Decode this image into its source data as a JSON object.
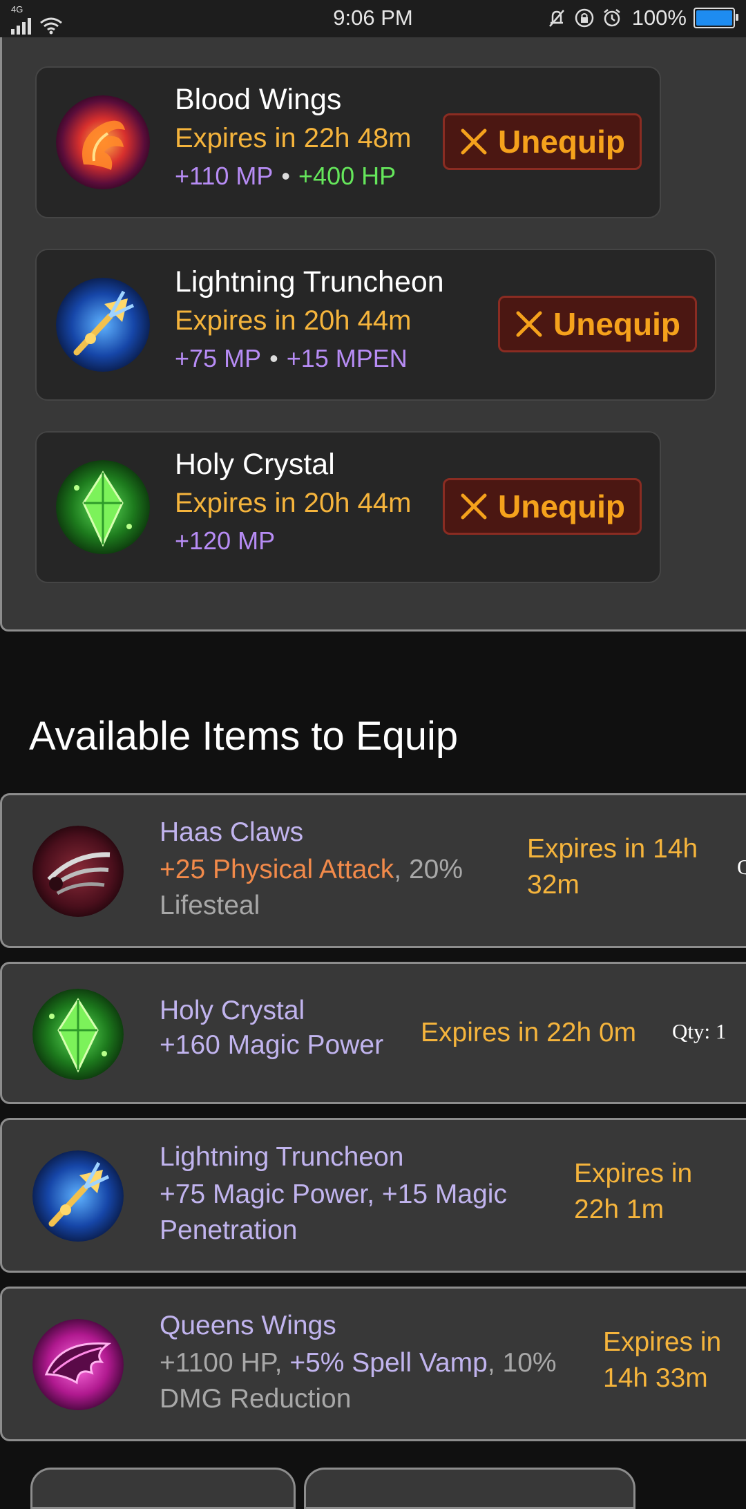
{
  "status_bar": {
    "network": "4G",
    "time": "9:06 PM",
    "battery_percent": "100%",
    "icons": [
      "signal-icon",
      "wifi-icon",
      "mute-icon",
      "rotation-lock-icon",
      "alarm-icon",
      "battery-icon"
    ]
  },
  "equipped": [
    {
      "name": "Blood Wings",
      "expires": "Expires in 22h 48m",
      "stats": [
        {
          "text": "+110 MP",
          "color": "purple"
        },
        {
          "text": "+400 HP",
          "color": "green"
        }
      ],
      "separator": "•",
      "action": "Unequip",
      "icon": "blood-wings-icon"
    },
    {
      "name": "Lightning Truncheon",
      "expires": "Expires in 20h 44m",
      "stats": [
        {
          "text": "+75 MP",
          "color": "purple"
        },
        {
          "text": "+15 MPEN",
          "color": "purple"
        }
      ],
      "separator": "•",
      "action": "Unequip",
      "icon": "lightning-truncheon-icon"
    },
    {
      "name": "Holy Crystal",
      "expires": "Expires in 20h 44m",
      "stats": [
        {
          "text": "+120 MP",
          "color": "purple"
        }
      ],
      "action": "Unequip",
      "icon": "holy-crystal-icon"
    }
  ],
  "available_title": "Available Items to Equip",
  "available": [
    {
      "name": "Haas Claws",
      "desc_highlight": "+25 Physical Attack",
      "desc_sep": ",",
      "desc_rest": " 20% Lifesteal",
      "expires_line1": "Expires in 14h",
      "expires_line2": "32m",
      "qty_partial": "Q",
      "icon": "haas-claws-icon"
    },
    {
      "name": "Holy Crystal",
      "desc_highlight": "+160 Magic Power",
      "expires_line1": "Expires in 22h 0m",
      "qty": "Qty: 1",
      "icon": "holy-crystal-icon"
    },
    {
      "name": "Lightning Truncheon",
      "desc_highlight": "+75 Magic Power, +15 Magic Penetration",
      "expires_line1": "Expires in",
      "expires_line2": "22h 1m",
      "icon": "lightning-truncheon-icon"
    },
    {
      "name": "Queens Wings",
      "desc_pre": "+1100 HP,",
      "desc_highlight": "+5% Spell Vamp",
      "desc_sep": ",",
      "desc_rest": " 10% DMG Reduction",
      "expires_line1": "Expires in",
      "expires_line2": "14h 33m",
      "icon": "queens-wings-icon"
    }
  ],
  "colors": {
    "background": "#101010",
    "panel": "#383838",
    "card": "#262626",
    "expires": "#f5b43c",
    "mp_purple": "#b78cf5",
    "hp_green": "#65e65b",
    "unequip_bg": "#4b1712",
    "unequip_text": "#f5a21c",
    "item_name": "#c1b4ee",
    "physical_attack": "#f28a4a"
  }
}
